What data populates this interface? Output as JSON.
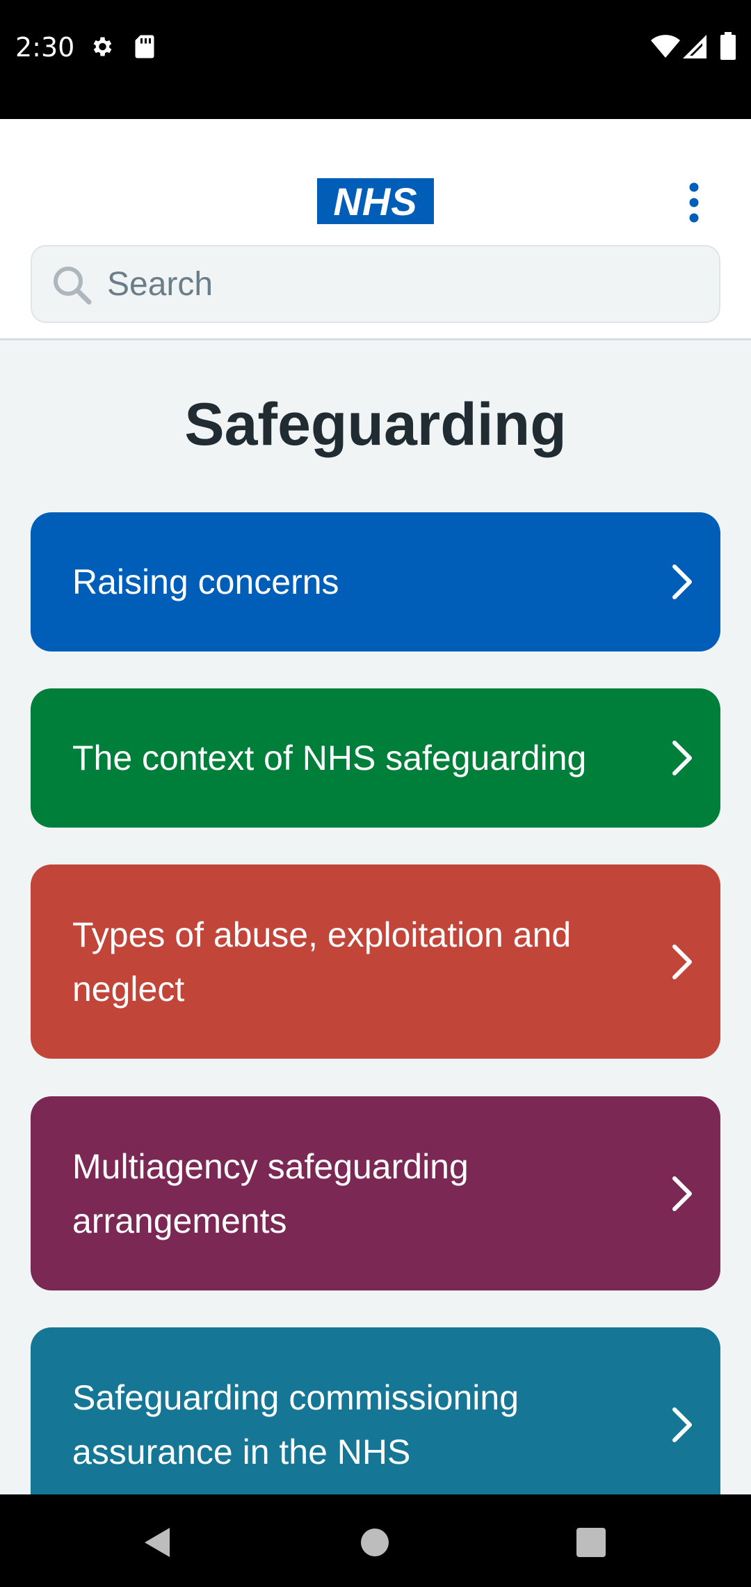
{
  "status_bar": {
    "time": "2:30",
    "icons": [
      "gear-icon",
      "sd-card-icon",
      "wifi-icon",
      "signal-icon",
      "battery-icon"
    ]
  },
  "header": {
    "logo_text": "NHS",
    "menu_icon": "more-vertical-icon",
    "search": {
      "placeholder": "Search",
      "icon": "search-icon"
    }
  },
  "page": {
    "title": "Safeguarding"
  },
  "cards": [
    {
      "label": "Raising concerns",
      "color": "#005eb8"
    },
    {
      "label": "The context of NHS safeguarding",
      "color": "#007f3b"
    },
    {
      "label": "Types of abuse, exploitation and neglect",
      "color": "#c2453a"
    },
    {
      "label": "Multiagency safeguarding arrangements",
      "color": "#7c2855"
    },
    {
      "label": "Safeguarding commissioning assurance in the NHS",
      "color": "#157795"
    }
  ],
  "nav_bar": {
    "icons": [
      "back-icon",
      "home-icon",
      "recents-icon"
    ]
  },
  "colors": {
    "nhs_blue": "#005eb8",
    "background": "#f0f4f5",
    "title_text": "#212b32"
  }
}
